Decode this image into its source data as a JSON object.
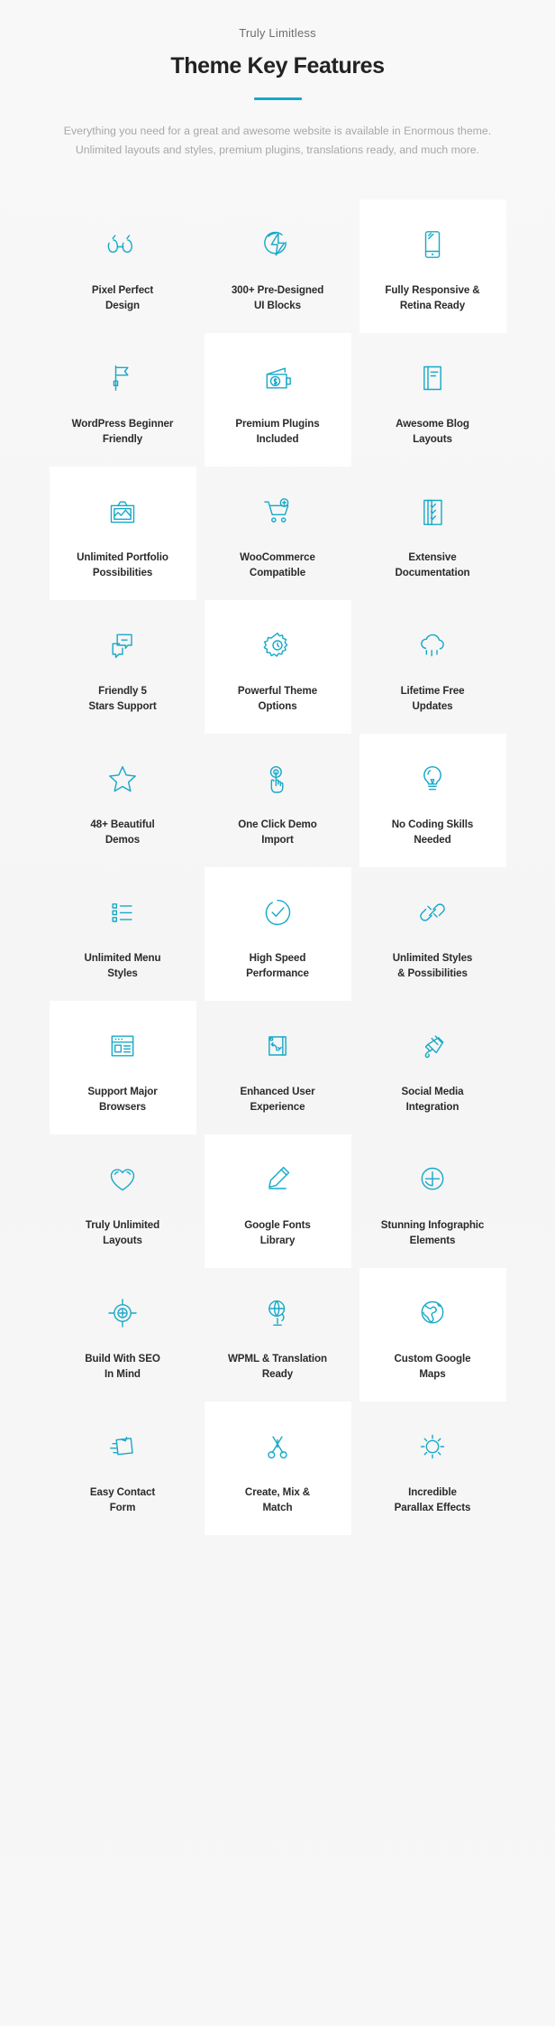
{
  "theme": {
    "accent": "#17a9c8",
    "background": "#f6f6f6",
    "card_highlight": "#ffffff",
    "heading_color": "#222222",
    "body_text_color": "#a8a8a8"
  },
  "header": {
    "eyebrow": "Truly Limitless",
    "title": "Theme Key Features",
    "subtitle": "Everything you need for a great and awesome website is available in Enormous theme. Unlimited layouts and styles, premium plugins, translations ready, and much more."
  },
  "features": [
    {
      "label": "Pixel Perfect\nDesign",
      "icon": "glasses-icon",
      "highlighted": false
    },
    {
      "label": "300+ Pre-Designed\nUI Blocks",
      "icon": "lightning-bolt-icon",
      "highlighted": false
    },
    {
      "label": "Fully Responsive &\nRetina Ready",
      "icon": "mobile-phone-icon",
      "highlighted": true
    },
    {
      "label": "WordPress Beginner\nFriendly",
      "icon": "flag-icon",
      "highlighted": false
    },
    {
      "label": "Premium Plugins\nIncluded",
      "icon": "wallet-money-icon",
      "highlighted": true
    },
    {
      "label": "Awesome Blog\nLayouts",
      "icon": "book-layout-icon",
      "highlighted": false
    },
    {
      "label": "Unlimited Portfolio\nPossibilities",
      "icon": "image-portfolio-icon",
      "highlighted": true
    },
    {
      "label": "WooCommerce\nCompatible",
      "icon": "shopping-cart-icon",
      "highlighted": false
    },
    {
      "label": "Extensive\nDocumentation",
      "icon": "checklist-document-icon",
      "highlighted": false
    },
    {
      "label": "Friendly 5\nStars Support",
      "icon": "chat-bubbles-icon",
      "highlighted": false
    },
    {
      "label": "Powerful Theme\nOptions",
      "icon": "gear-settings-icon",
      "highlighted": true
    },
    {
      "label": "Lifetime Free\nUpdates",
      "icon": "cloud-rain-icon",
      "highlighted": false
    },
    {
      "label": "48+ Beautiful\nDemos",
      "icon": "star-icon",
      "highlighted": false
    },
    {
      "label": "One Click Demo\nImport",
      "icon": "click-hand-icon",
      "highlighted": false
    },
    {
      "label": "No Coding Skills\nNeeded",
      "icon": "lightbulb-icon",
      "highlighted": true
    },
    {
      "label": "Unlimited Menu\nStyles",
      "icon": "list-menu-icon",
      "highlighted": false
    },
    {
      "label": "High Speed\nPerformance",
      "icon": "speed-check-icon",
      "highlighted": true
    },
    {
      "label": "Unlimited Styles\n& Possibilities",
      "icon": "chain-link-icon",
      "highlighted": false
    },
    {
      "label": "Support Major\nBrowsers",
      "icon": "browser-window-icon",
      "highlighted": true
    },
    {
      "label": "Enhanced User\nExperience",
      "icon": "design-board-icon",
      "highlighted": false
    },
    {
      "label": "Social Media\nIntegration",
      "icon": "megaphone-icon",
      "highlighted": false
    },
    {
      "label": "Truly Unlimited\nLayouts",
      "icon": "heart-icon",
      "highlighted": false
    },
    {
      "label": "Google Fonts\nLibrary",
      "icon": "pencil-write-icon",
      "highlighted": true
    },
    {
      "label": "Stunning Infographic\nElements",
      "icon": "plus-circle-icon",
      "highlighted": false
    },
    {
      "label": "Build With SEO\nIn Mind",
      "icon": "target-crosshair-icon",
      "highlighted": false
    },
    {
      "label": "WPML & Translation\nReady",
      "icon": "globe-stand-icon",
      "highlighted": false
    },
    {
      "label": "Custom Google\nMaps",
      "icon": "earth-globe-icon",
      "highlighted": true
    },
    {
      "label": "Easy Contact\nForm",
      "icon": "envelope-send-icon",
      "highlighted": false
    },
    {
      "label": "Create, Mix &\nMatch",
      "icon": "scissors-icon",
      "highlighted": true
    },
    {
      "label": "Incredible\nParallax Effects",
      "icon": "sun-icon",
      "highlighted": false
    }
  ]
}
